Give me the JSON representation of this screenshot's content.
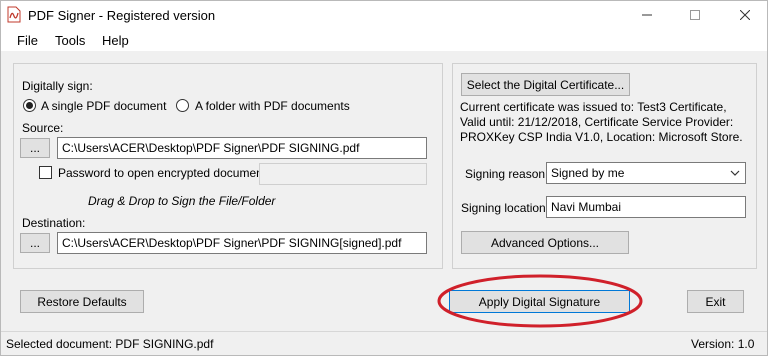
{
  "window": {
    "title": "PDF Signer - Registered version",
    "icon": "pdf-signer-app-icon",
    "controls": {
      "minimize": "minimize-icon",
      "maximize": "maximize-icon",
      "close": "close-icon"
    }
  },
  "menu": {
    "items": [
      "File",
      "Tools",
      "Help"
    ]
  },
  "sign_panel": {
    "digitally_sign_label": "Digitally sign:",
    "option_single": "A single PDF document",
    "option_folder": "A folder with PDF documents",
    "selected_option": "A single PDF document",
    "source_label": "Source:",
    "source_browse": "...",
    "source_path": "C:\\Users\\ACER\\Desktop\\PDF Signer\\PDF SIGNING.pdf",
    "password_label": "Password to open encrypted documents:",
    "password_checked": false,
    "password_value": "",
    "drag_drop_hint": "Drag & Drop to Sign the File/Folder",
    "destination_label": "Destination:",
    "destination_browse": "...",
    "destination_path": "C:\\Users\\ACER\\Desktop\\PDF Signer\\PDF SIGNING[signed].pdf"
  },
  "certificate_panel": {
    "select_button": "Select the Digital Certificate...",
    "certificate_info": "Current certificate was issued to: Test3 Certificate, Valid until: 21/12/2018, Certificate Service Provider: PROXKey CSP India V1.0, Location: Microsoft Store.",
    "signing_reason_label": "Signing reason:",
    "signing_reason_value": "Signed by me",
    "signing_location_label": "Signing location:",
    "signing_location_value": "Navi Mumbai",
    "advanced_button": "Advanced Options..."
  },
  "actions": {
    "restore_defaults": "Restore Defaults",
    "apply_signature": "Apply Digital Signature",
    "exit": "Exit"
  },
  "status": {
    "selected_document": "Selected document: PDF SIGNING.pdf",
    "version": "Version: 1.0"
  },
  "colors": {
    "window_bg": "#f0f0f0",
    "button_bg": "#e1e1e1",
    "focus_border": "#0078d7",
    "annotation_ellipse": "#d0202a",
    "app_icon_red": "#c0392b"
  }
}
